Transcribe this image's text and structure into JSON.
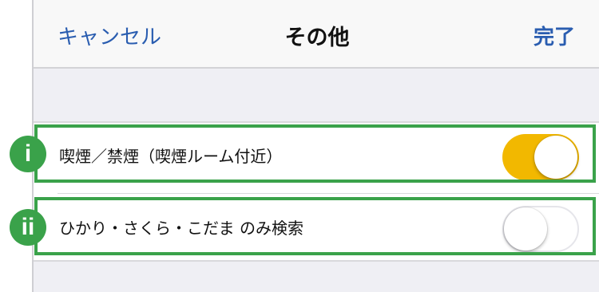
{
  "navbar": {
    "cancel_label": "キャンセル",
    "title": "その他",
    "done_label": "完了"
  },
  "settings": [
    {
      "label": "喫煙／禁煙（喫煙ルーム付近）",
      "enabled": true
    },
    {
      "label": "ひかり・さくら・こだま のみ検索",
      "enabled": false
    }
  ],
  "annotations": {
    "marker_1": "i",
    "marker_2": "ii"
  },
  "colors": {
    "accent_blue": "#2a5db0",
    "toggle_on": "#f2b800",
    "highlight_green": "#3aa24a"
  }
}
